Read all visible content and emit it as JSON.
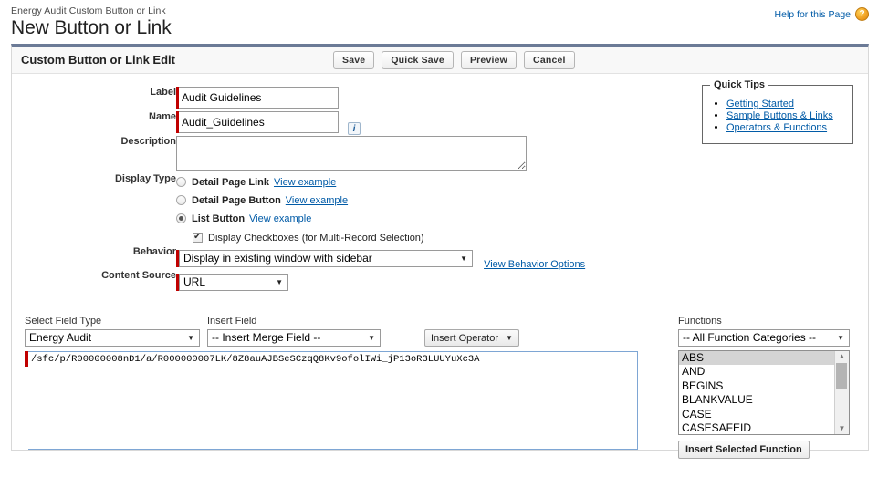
{
  "header": {
    "breadcrumb": "Energy Audit Custom Button or Link",
    "title": "New Button or Link",
    "help_link": "Help for this Page",
    "help_icon": "question-mark-icon"
  },
  "panel": {
    "title": "Custom Button or Link Edit",
    "buttons": [
      {
        "label": "Save",
        "name": "save-button"
      },
      {
        "label": "Quick Save",
        "name": "quick-save-button"
      },
      {
        "label": "Preview",
        "name": "preview-button"
      },
      {
        "label": "Cancel",
        "name": "cancel-button"
      }
    ]
  },
  "form": {
    "label_field": {
      "label": "Label",
      "value": "Audit Guidelines",
      "required": true
    },
    "name_field": {
      "label": "Name",
      "value": "Audit_Guidelines",
      "required": true,
      "info_icon": "info-icon"
    },
    "description_field": {
      "label": "Description",
      "value": "",
      "placeholder": ""
    },
    "display_type": {
      "label": "Display Type",
      "options": [
        {
          "label": "Detail Page Link",
          "example_link": "View example",
          "selected": false
        },
        {
          "label": "Detail Page Button",
          "example_link": "View example",
          "selected": false
        },
        {
          "label": "List Button",
          "example_link": "View example",
          "selected": true
        }
      ],
      "checkbox": {
        "label": "Display Checkboxes (for Multi-Record Selection)",
        "checked": true
      }
    },
    "behavior": {
      "label": "Behavior",
      "value": "Display in existing window with sidebar",
      "link": "View Behavior Options",
      "required": true
    },
    "content_source": {
      "label": "Content Source",
      "value": "URL",
      "required": true
    }
  },
  "quick_tips": {
    "title": "Quick Tips",
    "links": [
      "Getting Started",
      "Sample Buttons & Links",
      "Operators & Functions"
    ]
  },
  "formula_editor": {
    "field_type": {
      "label": "Select Field Type",
      "value": "Energy Audit"
    },
    "insert_field": {
      "label": "Insert Field",
      "value": "-- Insert Merge Field --"
    },
    "insert_operator": {
      "label": "Insert Operator"
    },
    "formula_value": "/sfc/p/R00000008nD1/a/R000000007LK/8Z8auAJBSeSCzqQ8Kv9ofolIWi_jP13oR3LUUYuXc3A",
    "functions": {
      "label": "Functions",
      "category": "-- All Function Categories --",
      "items": [
        "ABS",
        "AND",
        "BEGINS",
        "BLANKVALUE",
        "CASE",
        "CASESAFEID"
      ],
      "selected_index": 0,
      "insert_button": "Insert Selected Function"
    }
  },
  "colors": {
    "accent": "#6b7a96",
    "link": "#015ba7",
    "required": "#c00000",
    "focus_border": "#7ea6d4"
  }
}
